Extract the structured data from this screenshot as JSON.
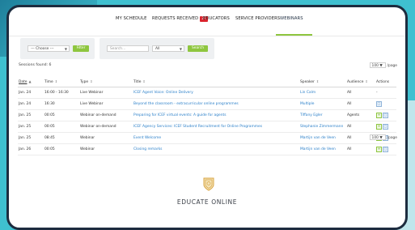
{
  "nav": {
    "items": [
      {
        "label": "MY SCHEDULE",
        "active": false
      },
      {
        "label": "REQUESTS RECEIVED",
        "badge": "21",
        "active": false
      },
      {
        "label": "EDUCATORS",
        "active": false
      },
      {
        "label": "SERVICE PROVIDERS",
        "active": false
      },
      {
        "label": "WEBINARS",
        "active": true
      }
    ]
  },
  "filters": {
    "left": {
      "select_value": "--- Choose ---",
      "button": "Filter"
    },
    "right": {
      "search_placeholder": "Search...",
      "type_select_value": "All",
      "button": "Search"
    }
  },
  "sessions_found": "Sessions found: 6",
  "per_page": {
    "value": "100",
    "suffix": "/page"
  },
  "table": {
    "columns": [
      "Date",
      "Time",
      "Type",
      "Title",
      "Speaker",
      "Audience",
      "Actions"
    ],
    "rows": [
      {
        "date": "Jan. 24",
        "time": "16:00 - 16:30",
        "type": "Live Webinar",
        "title": "ICEF Agent Voice: Online Delivery",
        "speaker": "Lin Calm",
        "audience": "All",
        "actions": "-"
      },
      {
        "date": "Jan. 24",
        "time": "16:30",
        "type": "Live Webinar",
        "title": "Beyond the classroom - extracurricular online programmes",
        "speaker": "Multiple",
        "audience": "All",
        "actions": "view"
      },
      {
        "date": "Jan. 25",
        "time": "00:05",
        "type": "Webinar on-demand",
        "title": "Preparing for ICEF virtual events: A guide for agents",
        "speaker": "Tiffany Egler",
        "audience": "Agents",
        "actions": "add-view"
      },
      {
        "date": "Jan. 25",
        "time": "00:05",
        "type": "Webinar on-demand",
        "title": "ICEF Agency Services: ICEF Student Recruitment for Online Programmes",
        "speaker": "Stephanie Zimmermann",
        "audience": "All",
        "actions": "add-view"
      },
      {
        "date": "Jan. 25",
        "time": "08:45",
        "type": "Webinar",
        "title": "Event Welcome",
        "speaker": "Martijn van de Veen",
        "audience": "All",
        "actions": "add-view"
      },
      {
        "date": "Jan. 26",
        "time": "00:05",
        "type": "Webinar",
        "title": "Closing remarks",
        "speaker": "Martijn van de Veen",
        "audience": "All",
        "actions": "add-view"
      }
    ]
  },
  "footer": {
    "logo_text": "EDUCATE ONLINE"
  },
  "colors": {
    "accent": "#8ec63f",
    "link": "#2a7fc9",
    "badge": "#d9232d",
    "frame": "#1d2c3f"
  }
}
